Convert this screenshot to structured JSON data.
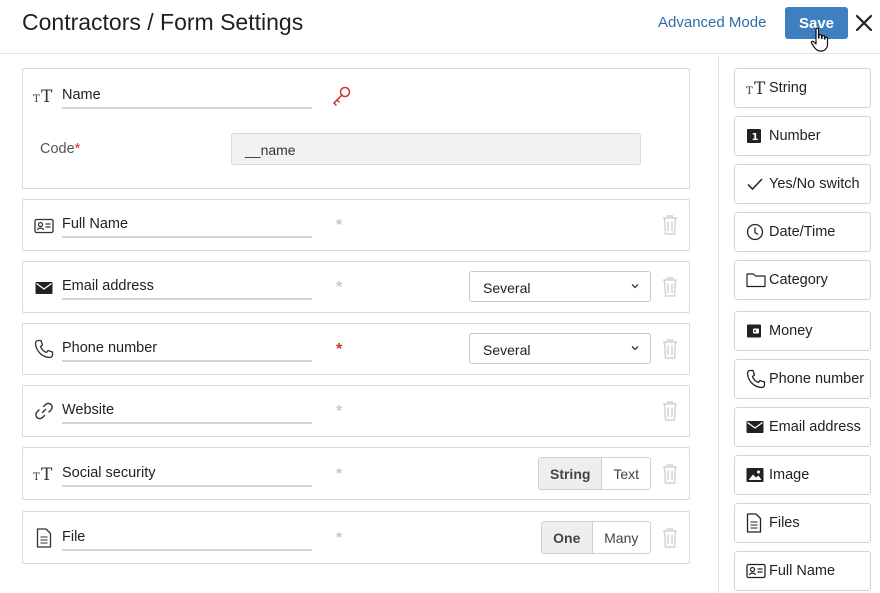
{
  "header": {
    "title": "Contractors / Form Settings",
    "advanced_mode": "Advanced Mode",
    "save": "Save"
  },
  "fields": {
    "name": {
      "label": "Name",
      "code_label": "Code",
      "code_required_mark": "*",
      "code_value": "__name"
    },
    "full_name": {
      "label": "Full Name",
      "required_mark": "*"
    },
    "email": {
      "label": "Email address",
      "required_mark": "*",
      "select_value": "Several"
    },
    "phone": {
      "label": "Phone number",
      "required_mark": "*",
      "select_value": "Several"
    },
    "website": {
      "label": "Website",
      "required_mark": "*"
    },
    "social": {
      "label": "Social security",
      "required_mark": "*",
      "toggle": [
        "String",
        "Text"
      ]
    },
    "file": {
      "label": "File",
      "required_mark": "*",
      "toggle": [
        "One",
        "Many"
      ]
    }
  },
  "palette": {
    "items": [
      {
        "label": "String",
        "icon": "string-icon"
      },
      {
        "label": "Number",
        "icon": "number-icon"
      },
      {
        "label": "Yes/No switch",
        "icon": "check-icon"
      },
      {
        "label": "Date/Time",
        "icon": "clock-icon"
      },
      {
        "label": "Category",
        "icon": "folder-icon"
      },
      {
        "label": "Money",
        "icon": "wallet-icon"
      },
      {
        "label": "Phone number",
        "icon": "phone-icon"
      },
      {
        "label": "Email address",
        "icon": "envelope-icon"
      },
      {
        "label": "Image",
        "icon": "image-icon"
      },
      {
        "label": "Files",
        "icon": "file-icon"
      },
      {
        "label": "Full Name",
        "icon": "id-card-icon"
      }
    ]
  },
  "colors": {
    "accent": "#3d7fc1",
    "link": "#2f6ea5",
    "required": "#d0312d"
  }
}
